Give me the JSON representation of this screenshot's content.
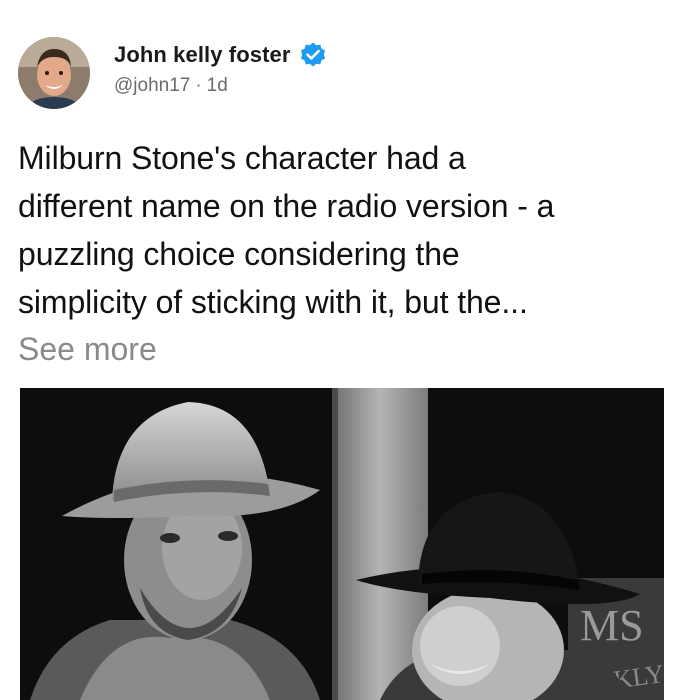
{
  "tweet": {
    "author": {
      "display_name": "John kelly foster",
      "handle": "@john17",
      "verified": true,
      "avatar_icon": "profile-photo"
    },
    "meta": {
      "separator": "·",
      "age": "1d"
    },
    "text_lines": [
      "Milburn Stone's character had a",
      "different name on the radio version - a",
      "puzzling choice considering the",
      "simplicity of sticking with it, but the..."
    ],
    "see_more_label": "See more",
    "media": {
      "type": "black-and-white photo",
      "sign_text_top": "MS",
      "sign_text_bottom": "EEKLY"
    }
  },
  "colors": {
    "verified_badge": "#1d9bf0",
    "see_more": "#8a8a8a",
    "meta_text": "#6b6b6b"
  }
}
